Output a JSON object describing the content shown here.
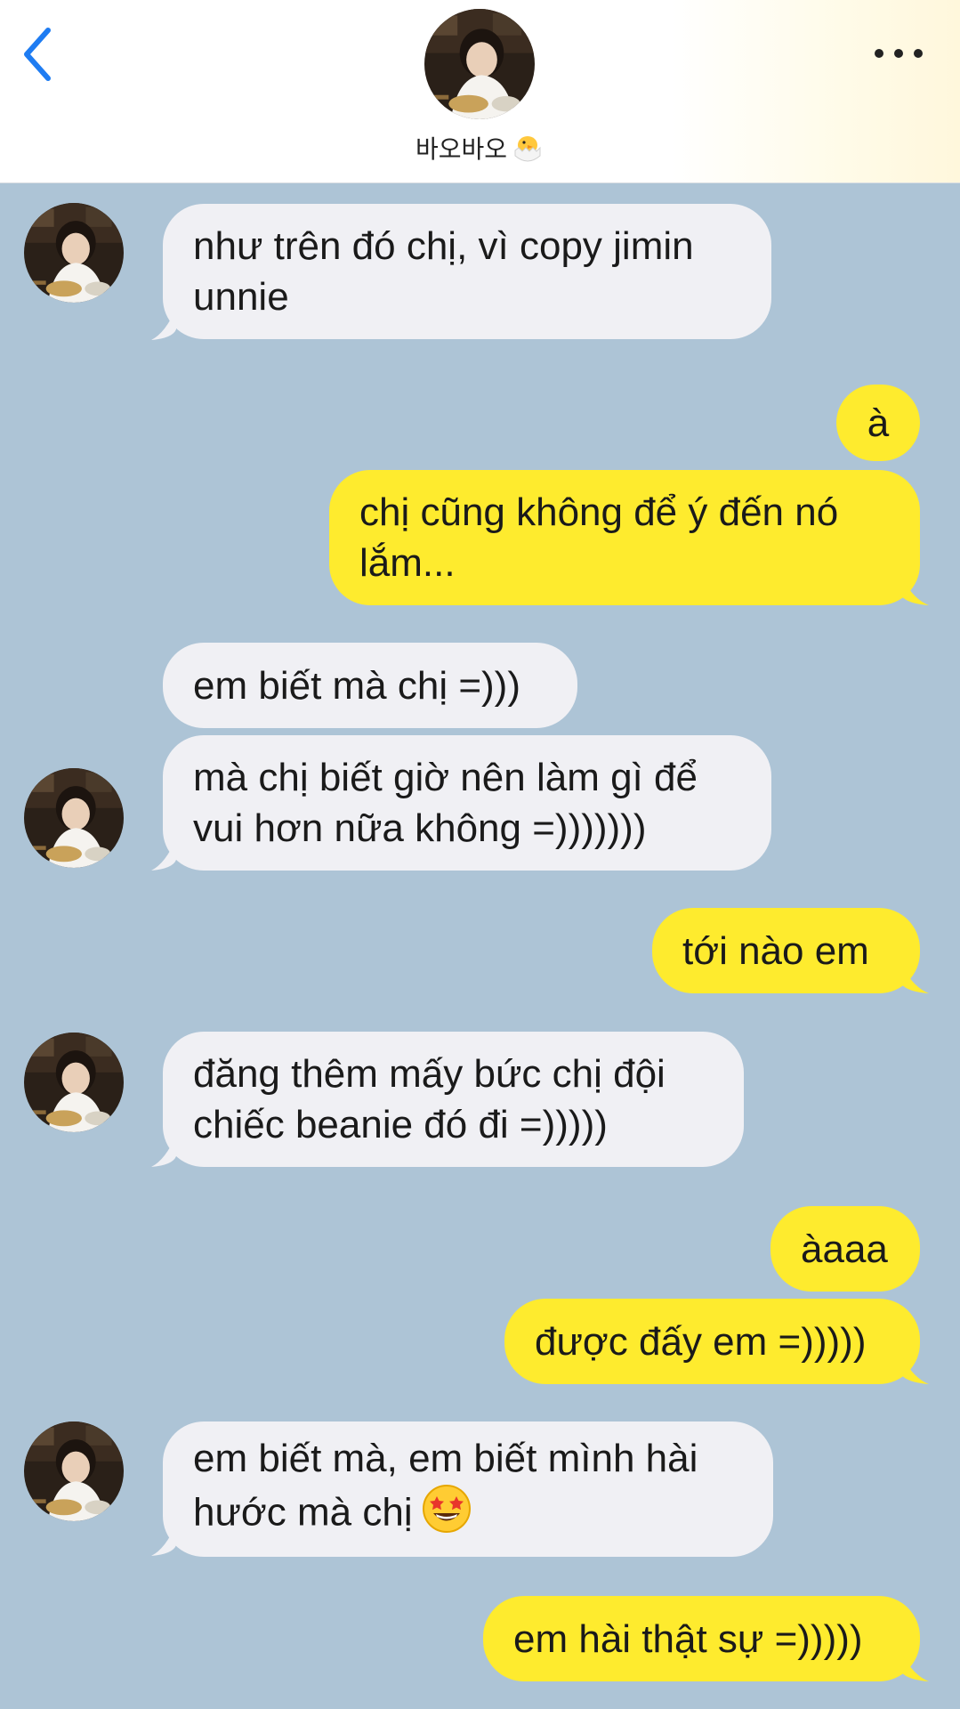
{
  "header": {
    "contact_name": "바오바오",
    "contact_emoji": "hatching-chick"
  },
  "icons": {
    "back": "chevron-left-icon",
    "more": "ellipsis-icon"
  },
  "colors": {
    "background": "#adc4d6",
    "incoming_bubble": "#f0f0f4",
    "outgoing_bubble": "#feeb2e",
    "accent_blue": "#1e7cf2"
  },
  "messages": [
    {
      "from": "them",
      "text": "như trên đó chị, vì copy jimin\nunnie"
    },
    {
      "from": "me",
      "text": "à"
    },
    {
      "from": "me",
      "text": "chị cũng không để ý đến nó\nlắm..."
    },
    {
      "from": "them",
      "text": "em biết mà chị =)))"
    },
    {
      "from": "them",
      "text": "mà chị biết giờ nên làm gì để\nvui hơn nữa không =)))))))"
    },
    {
      "from": "me",
      "text": "tới nào em"
    },
    {
      "from": "them",
      "text": "đăng thêm mấy bức chị đội\nchiếc beanie đó đi =)))))"
    },
    {
      "from": "me",
      "text": "àaaa"
    },
    {
      "from": "me",
      "text": "được đấy em =)))))"
    },
    {
      "from": "them",
      "text": "em biết mà, em biết mình hài\nhước mà chị",
      "emoji": "star-struck"
    },
    {
      "from": "me",
      "text": "em hài thật sự =)))))"
    }
  ]
}
